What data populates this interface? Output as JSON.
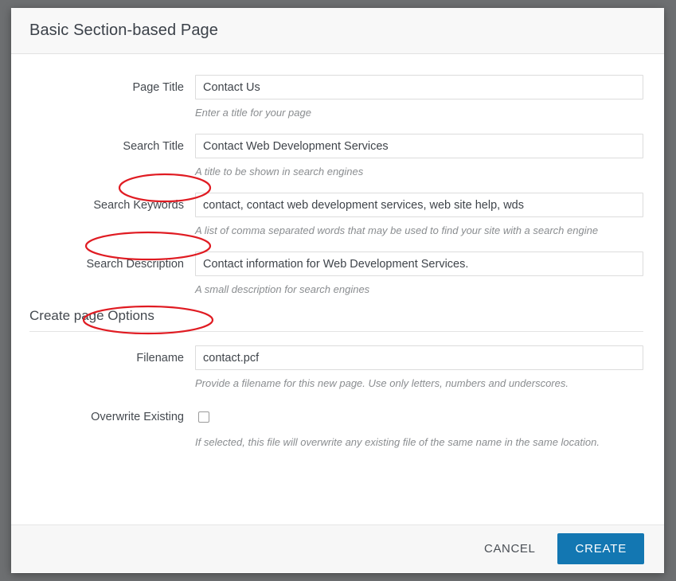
{
  "dialog": {
    "title": "Basic Section-based Page"
  },
  "fields": [
    {
      "label": "Page Title",
      "value": "Contact Us",
      "placeholder": "",
      "help": "Enter a title for your page",
      "annotated": false
    },
    {
      "label": "Search Title",
      "value": "Contact Web Development Services",
      "placeholder": "",
      "help": "A title to be shown in search engines",
      "annotated": true
    },
    {
      "label": "Search Keywords",
      "value": "contact, contact web development services, web site help, wds",
      "placeholder": "",
      "help": "A list of comma separated words that may be used to find your site with a search engine",
      "annotated": true
    },
    {
      "label": "Search Description",
      "value": "Contact information for Web Development Services.",
      "placeholder": "",
      "help": "A small description for search engines",
      "annotated": true
    }
  ],
  "section": {
    "heading": "Create page Options",
    "filename": {
      "label": "Filename",
      "value": "contact.pcf",
      "placeholder": "",
      "help": "Provide a filename for this new page. Use only letters, numbers and underscores."
    },
    "overwrite": {
      "label": "Overwrite Existing",
      "checked": false,
      "help": "If selected, this file will overwrite any existing file of the same name in the same location."
    }
  },
  "footer": {
    "cancel_label": "CANCEL",
    "create_label": "CREATE"
  },
  "colors": {
    "primary_button": "#1377b2",
    "annotation_red": "#e01b22",
    "header_bg": "#f8f8f8",
    "footer_bg": "#f7f7f7",
    "backdrop": "#6d6f71"
  }
}
